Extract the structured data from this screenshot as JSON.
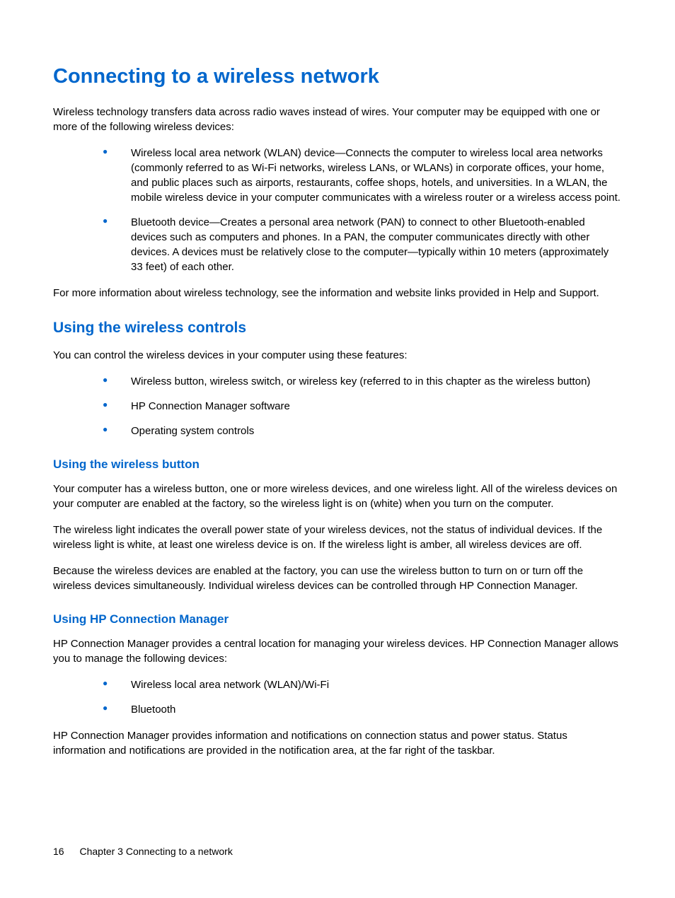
{
  "heading_main": "Connecting to a wireless network",
  "intro_para": "Wireless technology transfers data across radio waves instead of wires. Your computer may be equipped with one or more of the following wireless devices:",
  "intro_bullets": [
    "Wireless local area network (WLAN) device—Connects the computer to wireless local area networks (commonly referred to as Wi-Fi networks, wireless LANs, or WLANs) in corporate offices, your home, and public places such as airports, restaurants, coffee shops, hotels, and universities. In a WLAN, the mobile wireless device in your computer communicates with a wireless router or a wireless access point.",
    "Bluetooth device—Creates a personal area network (PAN) to connect to other Bluetooth-enabled devices such as computers and phones. In a PAN, the computer communicates directly with other devices. A devices must be relatively close to the computer—typically within 10 meters (approximately 33 feet) of each other."
  ],
  "intro_after": "For more information about wireless technology, see the information and website links provided in Help and Support.",
  "section_controls": {
    "heading": "Using the wireless controls",
    "intro": "You can control the wireless devices in your computer using these features:",
    "bullets": [
      "Wireless button, wireless switch, or wireless key (referred to in this chapter as the wireless button)",
      "HP Connection Manager software",
      "Operating system controls"
    ]
  },
  "section_button": {
    "heading": "Using the wireless button",
    "paras": [
      "Your computer has a wireless button, one or more wireless devices, and one wireless light. All of the wireless devices on your computer are enabled at the factory, so the wireless light is on (white) when you turn on the computer.",
      "The wireless light indicates the overall power state of your wireless devices, not the status of individual devices. If the wireless light is white, at least one wireless device is on. If the wireless light is amber, all wireless devices are off.",
      "Because the wireless devices are enabled at the factory, you can use the wireless button to turn on or turn off the wireless devices simultaneously. Individual wireless devices can be controlled through HP Connection Manager."
    ]
  },
  "section_hpcm": {
    "heading": "Using HP Connection Manager",
    "intro": "HP Connection Manager provides a central location for managing your wireless devices. HP Connection Manager allows you to manage the following devices:",
    "bullets": [
      "Wireless local area network (WLAN)/Wi-Fi",
      "Bluetooth"
    ],
    "after": "HP Connection Manager provides information and notifications on connection status and power status. Status information and notifications are provided in the notification area, at the far right of the taskbar."
  },
  "footer": {
    "page_num": "16",
    "chapter": "Chapter 3   Connecting to a network"
  }
}
